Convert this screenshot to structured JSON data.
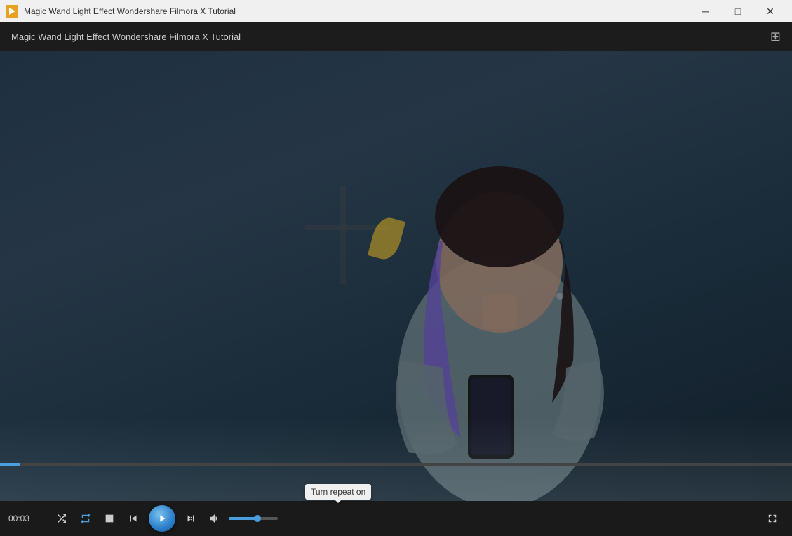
{
  "titlebar": {
    "app_icon_color": "#e8a020",
    "window_title": "Magic Wand Light Effect  Wondershare Filmora X Tutorial",
    "min_label": "─",
    "max_label": "□",
    "close_label": "✕"
  },
  "appbar": {
    "title": "Magic Wand Light Effect  Wondershare Filmora X Tutorial",
    "grid_icon": "⊞"
  },
  "controls": {
    "time": "00:03",
    "shuffle_tooltip": "Shuffle",
    "repeat_tooltip": "Turn repeat on",
    "stop_label": "■",
    "prev_label": "⏮",
    "play_label": "▶",
    "next_label": "⏭",
    "volume_label": "🔊",
    "fullscreen_label": "⛶"
  },
  "tooltip": {
    "text": "Turn repeat on"
  },
  "progress": {
    "percent": 2.5
  }
}
